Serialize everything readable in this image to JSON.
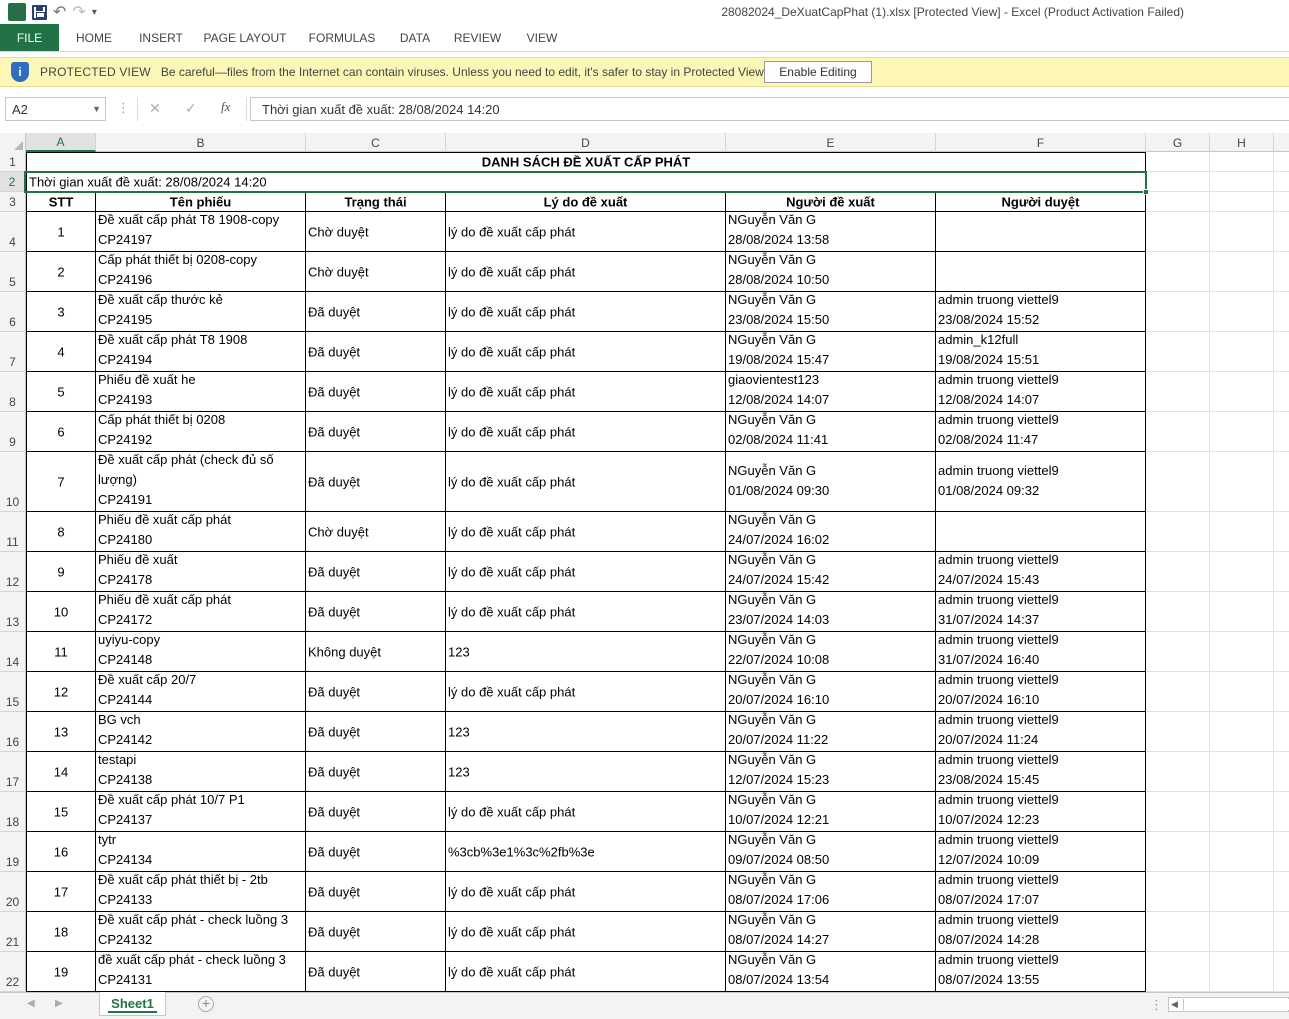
{
  "window": {
    "title": "28082024_DeXuatCapPhat (1).xlsx  [Protected View] - Excel (Product Activation Failed)",
    "icons": [
      "excel-logo-icon",
      "save-icon",
      "undo-icon",
      "redo-icon",
      "customize-qat-icon"
    ]
  },
  "qat": {
    "excel_logo": "X",
    "undo": "↶",
    "redo": "↷",
    "customize": "▾"
  },
  "ribbon": {
    "tabs": [
      "FILE",
      "HOME",
      "INSERT",
      "PAGE LAYOUT",
      "FORMULAS",
      "DATA",
      "REVIEW",
      "VIEW"
    ]
  },
  "protected_view": {
    "title": "PROTECTED VIEW",
    "message": "Be careful—files from the Internet can contain viruses. Unless you need to edit, it's safer to stay in Protected View.",
    "button": "Enable Editing",
    "icon": "i"
  },
  "formula_bar": {
    "name_box": "A2",
    "cancel": "✕",
    "enter": "✓",
    "fx": "fx",
    "value": "Thời gian xuất đề xuất: 28/08/2024 14:20"
  },
  "grid": {
    "columns": [
      "A",
      "B",
      "C",
      "D",
      "E",
      "F",
      "G",
      "H"
    ],
    "row_numbers": [
      "1",
      "2",
      "3",
      "4",
      "5",
      "6",
      "7",
      "8",
      "9",
      "10",
      "11",
      "12",
      "13",
      "14",
      "15",
      "16",
      "17",
      "18",
      "19",
      "20",
      "21",
      "22"
    ],
    "selected_cell": "A2",
    "title": "DANH SÁCH ĐỀ XUẤT CẤP PHÁT",
    "export_time": "Thời gian xuất đề xuất: 28/08/2024 14:20",
    "headers": [
      "STT",
      "Tên phiếu",
      "Trạng thái",
      "Lý do đề xuất",
      "Người đề xuất",
      "Người duyệt"
    ],
    "rows": [
      {
        "stt": "1",
        "name": "Đề xuất cấp phát T8 1908-copy",
        "code": "CP24197",
        "status": "Chờ duyệt",
        "reason": "lý do đề xuất cấp phát",
        "proposer": "NGuyễn Văn G",
        "proposed_at": "28/08/2024 13:58",
        "approver": "",
        "approved_at": ""
      },
      {
        "stt": "2",
        "name": "Cấp phát thiết bị 0208-copy",
        "code": "CP24196",
        "status": "Chờ duyệt",
        "reason": "lý do đề xuất cấp phát",
        "proposer": "NGuyễn Văn G",
        "proposed_at": "28/08/2024 10:50",
        "approver": "",
        "approved_at": ""
      },
      {
        "stt": "3",
        "name": "Đề xuất cấp thước kẻ",
        "code": "CP24195",
        "status": "Đã duyệt",
        "reason": "lý do đề xuất cấp phát",
        "proposer": "NGuyễn Văn G",
        "proposed_at": "23/08/2024 15:50",
        "approver": "admin truong viettel9",
        "approved_at": "23/08/2024 15:52"
      },
      {
        "stt": "4",
        "name": "Đề xuất cấp phát T8 1908",
        "code": "CP24194",
        "status": "Đã duyệt",
        "reason": "lý do đề xuất cấp phát",
        "proposer": "NGuyễn Văn G",
        "proposed_at": "19/08/2024 15:47",
        "approver": "admin_k12full",
        "approved_at": "19/08/2024 15:51"
      },
      {
        "stt": "5",
        "name": "Phiếu đề xuất he",
        "code": "CP24193",
        "status": "Đã duyệt",
        "reason": "lý do đề xuất cấp phát",
        "proposer": "giaovientest123",
        "proposed_at": "12/08/2024 14:07",
        "approver": "admin truong viettel9",
        "approved_at": "12/08/2024 14:07"
      },
      {
        "stt": "6",
        "name": "Cấp phát thiết bị 0208",
        "code": "CP24192",
        "status": "Đã duyệt",
        "reason": "lý do đề xuất cấp phát",
        "proposer": "NGuyễn Văn G",
        "proposed_at": "02/08/2024 11:41",
        "approver": "admin truong viettel9",
        "approved_at": "02/08/2024 11:47"
      },
      {
        "stt": "7",
        "name": "Đề xuất cấp phát (check đủ số lượng)",
        "code": "CP24191",
        "status": "Đã duyệt",
        "reason": "lý do đề xuất cấp phát",
        "proposer": "NGuyễn Văn G",
        "proposed_at": "01/08/2024 09:30",
        "approver": "admin truong viettel9",
        "approved_at": "01/08/2024 09:32"
      },
      {
        "stt": "8",
        "name": "Phiếu đề xuất cấp phát",
        "code": "CP24180",
        "status": "Chờ duyệt",
        "reason": "lý do đề xuất cấp phát",
        "proposer": "NGuyễn Văn G",
        "proposed_at": "24/07/2024 16:02",
        "approver": "",
        "approved_at": ""
      },
      {
        "stt": "9",
        "name": "Phiếu đề xuất",
        "code": "CP24178",
        "status": "Đã duyệt",
        "reason": "lý do đề xuất cấp phát",
        "proposer": "NGuyễn Văn G",
        "proposed_at": "24/07/2024 15:42",
        "approver": "admin truong viettel9",
        "approved_at": "24/07/2024 15:43"
      },
      {
        "stt": "10",
        "name": "Phiếu đề xuất cấp phát",
        "code": "CP24172",
        "status": "Đã duyệt",
        "reason": "lý do đề xuất cấp phát",
        "proposer": "NGuyễn Văn G",
        "proposed_at": "23/07/2024 14:03",
        "approver": "admin truong viettel9",
        "approved_at": "31/07/2024 14:37"
      },
      {
        "stt": "11",
        "name": "uyiyu-copy",
        "code": "CP24148",
        "status": "Không duyệt",
        "reason": "123",
        "proposer": "NGuyễn Văn G",
        "proposed_at": "22/07/2024 10:08",
        "approver": "admin truong viettel9",
        "approved_at": "31/07/2024 16:40"
      },
      {
        "stt": "12",
        "name": "Đề xuất cấp 20/7",
        "code": "CP24144",
        "status": "Đã duyệt",
        "reason": "lý do đề xuất cấp phát",
        "proposer": "NGuyễn Văn G",
        "proposed_at": "20/07/2024 16:10",
        "approver": "admin truong viettel9",
        "approved_at": "20/07/2024 16:10"
      },
      {
        "stt": "13",
        "name": "BG vch",
        "code": "CP24142",
        "status": "Đã duyệt",
        "reason": "123",
        "proposer": "NGuyễn Văn G",
        "proposed_at": "20/07/2024 11:22",
        "approver": "admin truong viettel9",
        "approved_at": "20/07/2024 11:24"
      },
      {
        "stt": "14",
        "name": "testapi",
        "code": "CP24138",
        "status": "Đã duyệt",
        "reason": "123",
        "proposer": "NGuyễn Văn G",
        "proposed_at": "12/07/2024 15:23",
        "approver": "admin truong viettel9",
        "approved_at": "23/08/2024 15:45"
      },
      {
        "stt": "15",
        "name": "Đề xuất cấp phát 10/7 P1",
        "code": "CP24137",
        "status": "Đã duyệt",
        "reason": "lý do đề xuất cấp phát",
        "proposer": "NGuyễn Văn G",
        "proposed_at": "10/07/2024 12:21",
        "approver": "admin truong viettel9",
        "approved_at": "10/07/2024 12:23"
      },
      {
        "stt": "16",
        "name": "tytr",
        "code": "CP24134",
        "status": "Đã duyệt",
        "reason": "%3cb%3e1%3c%2fb%3e",
        "proposer": "NGuyễn Văn G",
        "proposed_at": "09/07/2024 08:50",
        "approver": "admin truong viettel9",
        "approved_at": "12/07/2024 10:09"
      },
      {
        "stt": "17",
        "name": "Đề xuất cấp phát thiết bị - 2tb",
        "code": "CP24133",
        "status": "Đã duyệt",
        "reason": "lý do đề xuất cấp phát",
        "proposer": "NGuyễn Văn G",
        "proposed_at": "08/07/2024 17:06",
        "approver": "admin truong viettel9",
        "approved_at": "08/07/2024 17:07"
      },
      {
        "stt": "18",
        "name": "Đề xuất cấp phát - check luồng 3",
        "code": "CP24132",
        "status": "Đã duyệt",
        "reason": "lý do đề xuất cấp phát",
        "proposer": "NGuyễn Văn G",
        "proposed_at": "08/07/2024 14:27",
        "approver": "admin truong viettel9",
        "approved_at": "08/07/2024 14:28"
      },
      {
        "stt": "19",
        "name": "đề xuất cấp phát - check luồng 3",
        "code": "CP24131",
        "status": "Đã duyệt",
        "reason": "lý do đề xuất cấp phát",
        "proposer": "NGuyễn Văn G",
        "proposed_at": "08/07/2024 13:54",
        "approver": "admin truong viettel9",
        "approved_at": "08/07/2024 13:55"
      }
    ]
  },
  "sheets": {
    "tabs": [
      "Sheet1"
    ],
    "active": "Sheet1",
    "prev": "◀",
    "next": "▶",
    "add": "+",
    "more": "⋮",
    "scroll_left": "◀"
  }
}
